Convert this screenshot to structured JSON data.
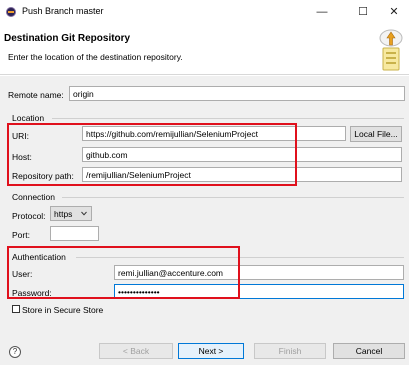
{
  "window": {
    "title": "Push Branch master",
    "minimize_glyph": "—",
    "maximize_glyph": "☐",
    "close_glyph": "✕"
  },
  "header": {
    "title": "Destination Git Repository",
    "description": "Enter the location of the destination repository.",
    "icon": "push-to-remote-icon"
  },
  "remote": {
    "label": "Remote name:",
    "value": "origin"
  },
  "location": {
    "title": "Location",
    "uri_label": "URI:",
    "uri_value": "https://github.com/remijullian/SeleniumProject",
    "local_file_button": "Local File...",
    "host_label": "Host:",
    "host_value": "github.com",
    "repo_path_label": "Repository path:",
    "repo_path_value": "/remijullian/SeleniumProject"
  },
  "connection": {
    "title": "Connection",
    "protocol_label": "Protocol:",
    "protocol_value": "https",
    "port_label": "Port:",
    "port_value": ""
  },
  "authentication": {
    "title": "Authentication",
    "user_label": "User:",
    "user_value": "remi.jullian@accenture.com",
    "password_label": "Password:",
    "password_value": "••••••••••••••",
    "store_label": "Store in Secure Store"
  },
  "footer": {
    "help_glyph": "?",
    "back_label": "< Back",
    "next_label": "Next >",
    "finish_label": "Finish",
    "cancel_label": "Cancel"
  },
  "colors": {
    "highlight_border": "#e0101c",
    "dialog_background": "#f0f0f0",
    "primary_button_border": "#0078d7"
  }
}
